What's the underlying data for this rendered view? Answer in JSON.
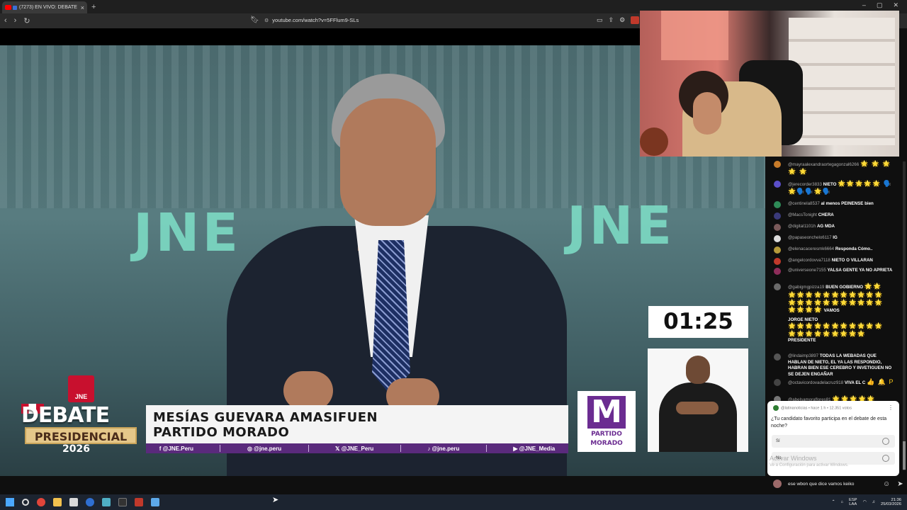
{
  "browser": {
    "tab_title": "(7273) EN VIVO: DEBATE PRE",
    "tab_close": "×",
    "new_tab": "+",
    "url": "youtube.com/watch?v=5FFlum9-SLs",
    "window_controls": [
      "–",
      "▢",
      "✕"
    ],
    "nav": [
      "‹",
      "›",
      "↻"
    ]
  },
  "video": {
    "bg_logo_1": "JNE",
    "bg_logo_2": "JNE",
    "jne_badge": "JNE",
    "debate_word": "DEBATE",
    "presidencial_word": "PRESIDENCIAL",
    "year": "2026",
    "speaker_name": "MESÍAS GUEVARA AMASIFUEN",
    "speaker_party": "PARTIDO MORADO",
    "socials": [
      {
        "icon": "f",
        "text": "@JNE.Peru"
      },
      {
        "icon": "◎",
        "text": "@jne.peru"
      },
      {
        "icon": "𝕏",
        "text": "@JNE_Peru"
      },
      {
        "icon": "♪",
        "text": "@jne.peru"
      },
      {
        "icon": "▶",
        "text": "@JNE_Media"
      }
    ],
    "party_logo_letter": "M",
    "party_logo_text_1": "PARTIDO",
    "party_logo_text_2": "MORADO",
    "timer": "01:25"
  },
  "chat": {
    "messages": [
      {
        "user": "@mayraalexandraortegagonzal6266",
        "text": "",
        "emoji": "🌟 🌟 🌟 🌟 🌟",
        "avatar_color": "#c77b2a"
      },
      {
        "user": "@jerecorder3833",
        "text": "NIETO",
        "emoji": "🌟🌟🌟🌟🌟 🗣️🌟🗣️🗣️🌟🗣️",
        "avatar_color": "#5b4fc9"
      },
      {
        "user": "@centinela8537",
        "text": "al menos PEINENSE bien",
        "emoji": "",
        "avatar_color": "#2e8b57"
      },
      {
        "user": "@MacsTonight",
        "text": "CHERA",
        "emoji": "",
        "avatar_color": "#3a3a7a"
      },
      {
        "user": "@digital1101h",
        "text": "AG MDA",
        "emoji": "",
        "avatar_color": "#7a5a5a"
      },
      {
        "user": "@papaseonchelo6117",
        "text": "IG",
        "emoji": "",
        "avatar_color": "#dddddd"
      },
      {
        "user": "@elenacaceresmk6664",
        "text": "Responda Cómo..",
        "emoji": "",
        "avatar_color": "#b59a3a"
      },
      {
        "user": "@angelcordovva7118",
        "text": "NIETO O VILLARAN",
        "emoji": "",
        "avatar_color": "#c0392b"
      },
      {
        "user": "@universeone7155",
        "text": "YALSA GENTE YA NO APRIETA",
        "emoji": "",
        "avatar_color": "#8e2d5a"
      },
      {
        "user": "@gabigmgpizza19",
        "text": "BUEN GOBIERNO",
        "emoji": "🌟🌟",
        "avatar_color": "#6a6a6a"
      },
      {
        "user": "",
        "text": "VAMOS",
        "emoji": "🌟🌟🌟🌟🌟🌟🌟🌟🌟🌟🌟🌟🌟🌟🌟🌟🌟🌟🌟🌟🌟🌟🌟🌟🌟🌟",
        "avatar_color": ""
      },
      {
        "user": "",
        "text": "JORGE NIETO",
        "emoji": "",
        "avatar_color": ""
      },
      {
        "user": "",
        "text": "PRESIDENTE",
        "emoji": "🌟🌟🌟🌟🌟🌟🌟🌟🌟🌟🌟🌟🌟🌟🌟🌟🌟🌟🌟🌟",
        "avatar_color": ""
      },
      {
        "user": "@lindaimp3897",
        "text": "TODAS LA WEBADAS QUE HABLAN DE NIETO, EL YA LAS RESPONDIO, HABRAN BIEN ESE CEREBRO Y INVETIGUEN NO SE DEJEN ENGAÑAR",
        "emoji": "",
        "avatar_color": "#555555"
      },
      {
        "user": "@octavicordovadelacruz918",
        "text": "VIVA EL C",
        "emoji": "👍 🔔 P",
        "avatar_color": "#444444"
      },
      {
        "user": "@abelsamoraflores81",
        "text": "",
        "emoji": "🌟🌟🌟🌟🌟",
        "avatar_color": "#777777"
      }
    ],
    "poll": {
      "source": "@latinanoticias • hace 1 h • 12.351 votos",
      "question": "¿Tu candidato favorito participa en el debate de esta noche?",
      "options": [
        "Sí",
        "No"
      ],
      "menu": "⋮"
    },
    "watermark_1": "Activar Windows",
    "watermark_2": "Ve a Configuración para activar Windows.",
    "input_text": "ese wbon que dice vamos keiko"
  },
  "taskbar": {
    "lang_1": "ESP",
    "lang_2": "LAA",
    "time": "21:36",
    "date": "25/03/2026"
  }
}
